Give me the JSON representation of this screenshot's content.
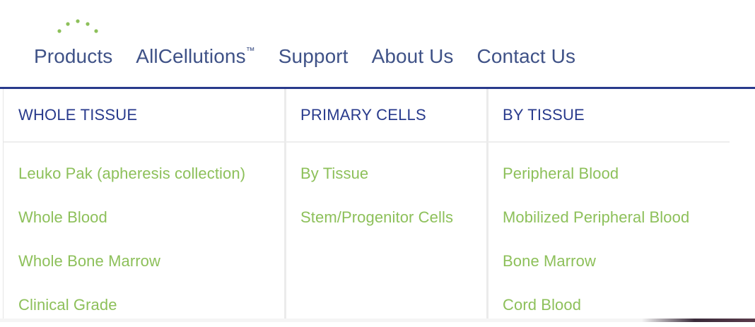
{
  "brand": {
    "logo_dots_color": "#8dc05a"
  },
  "nav": {
    "items": [
      {
        "label": "Products"
      },
      {
        "label": "AllCellutions",
        "suffix": "™"
      },
      {
        "label": "Support"
      },
      {
        "label": "About Us"
      },
      {
        "label": "Contact Us"
      }
    ]
  },
  "menu": {
    "columns": [
      {
        "heading": "WHOLE TISSUE",
        "items": [
          "Leuko Pak (apheresis collection)",
          "Whole Blood",
          "Whole Bone Marrow",
          "Clinical Grade"
        ]
      },
      {
        "heading": "PRIMARY CELLS",
        "items": [
          "By Tissue",
          "Stem/Progenitor Cells"
        ]
      },
      {
        "heading": "BY TISSUE",
        "items": [
          "Peripheral Blood",
          "Mobilized Peripheral Blood",
          "Bone Marrow",
          "Cord Blood"
        ]
      }
    ]
  },
  "colors": {
    "nav_text": "#3f5287",
    "heading": "#283a8c",
    "link": "#8dc05a",
    "accent_line": "#283a8c"
  }
}
